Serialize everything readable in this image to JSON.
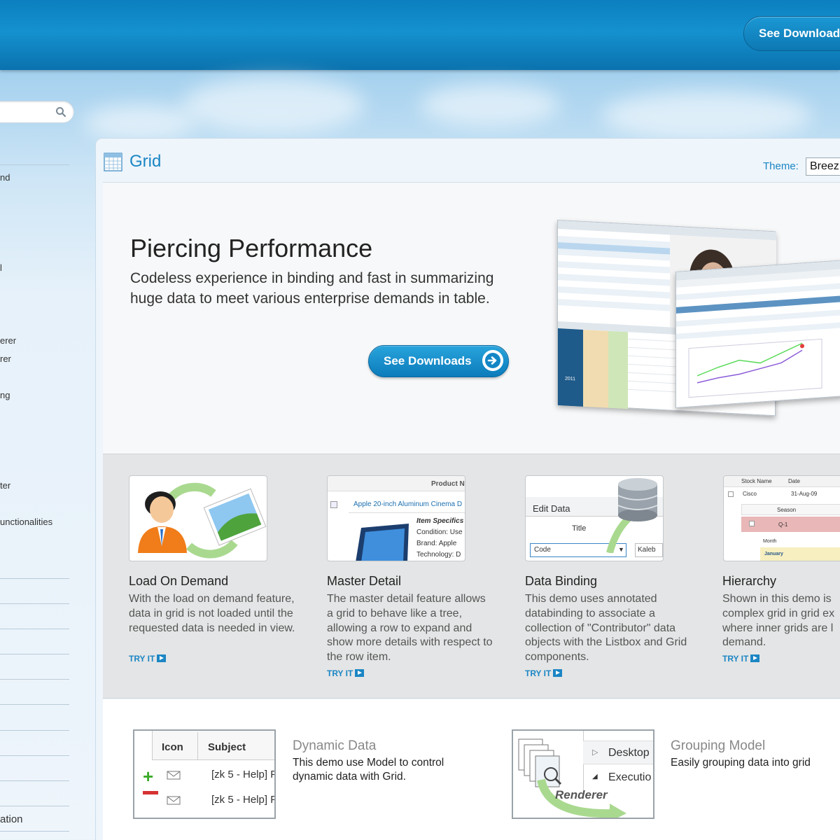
{
  "header": {
    "download_label": "See Downloads"
  },
  "search": {
    "placeholder": ""
  },
  "sidebar": {
    "items": [
      {
        "label": "nd"
      },
      {
        "label": "l"
      },
      {
        "label": "erer"
      },
      {
        "label": "rer"
      },
      {
        "label": "ng"
      },
      {
        "label": "ter"
      },
      {
        "label": "unctionalities"
      },
      {
        "label": "ation"
      }
    ]
  },
  "panel": {
    "title": "Grid",
    "theme_label": "Theme:",
    "theme_value": "Breez"
  },
  "hero": {
    "title": "Piercing Performance",
    "description": "Codeless experience in binding and fast in summarizing huge data to meet various enterprise demands in table.",
    "button_label": "See Downloads",
    "preview_year": "2011"
  },
  "demos": [
    {
      "title": "Load On Demand",
      "description": "With the load on demand feature, data in grid is not loaded until the requested data is needed in view.",
      "try_label": "TRY IT"
    },
    {
      "title": "Master Detail",
      "description": "The master detail feature allows a grid to behave like a tree, allowing a row to expand and show more details with respect to the row item.",
      "try_label": "TRY IT",
      "thumb": {
        "header": "Product N",
        "product": "Apple 20-inch Aluminum Cinema D",
        "specifics": "Item Specifics",
        "condition": "Condition: Use",
        "brand": "Brand: Apple",
        "technology": "Technology: D"
      }
    },
    {
      "title": "Data Binding",
      "description": "This demo uses annotated databinding to associate a collection of \"Contributor\" data objects with the Listbox and Grid components.",
      "try_label": "TRY IT",
      "thumb": {
        "edit": "Edit Data",
        "title": "Title",
        "input": "Code",
        "name": "Kaleb"
      }
    },
    {
      "title": "Hierarchy",
      "description": "Shown in this demo is complex grid in grid ex where inner grids are l demand.",
      "try_label": "TRY IT",
      "thumb": {
        "col1": "Stock Name",
        "col2": "Date",
        "row_name": "Cisco",
        "row_date": "31-Aug-09",
        "season": "Season",
        "q1": "Q-1",
        "month": "Month",
        "january": "January"
      }
    }
  ],
  "bottom": [
    {
      "title": "Dynamic Data",
      "description": "This demo use Model to control dynamic data with Grid.",
      "thumb": {
        "col_icon": "Icon",
        "col_subject": "Subject",
        "row1": "[zk 5 - Help] F",
        "row2": "[zk 5 - Help] F"
      }
    },
    {
      "title": "Grouping Model",
      "description": "Easily grouping data into grid",
      "thumb": {
        "item1": "Desktop",
        "item2": "Executio",
        "renderer": "Renderer"
      }
    }
  ],
  "colors": {
    "accent": "#1b86c4",
    "banner": "#0b7fbf"
  }
}
